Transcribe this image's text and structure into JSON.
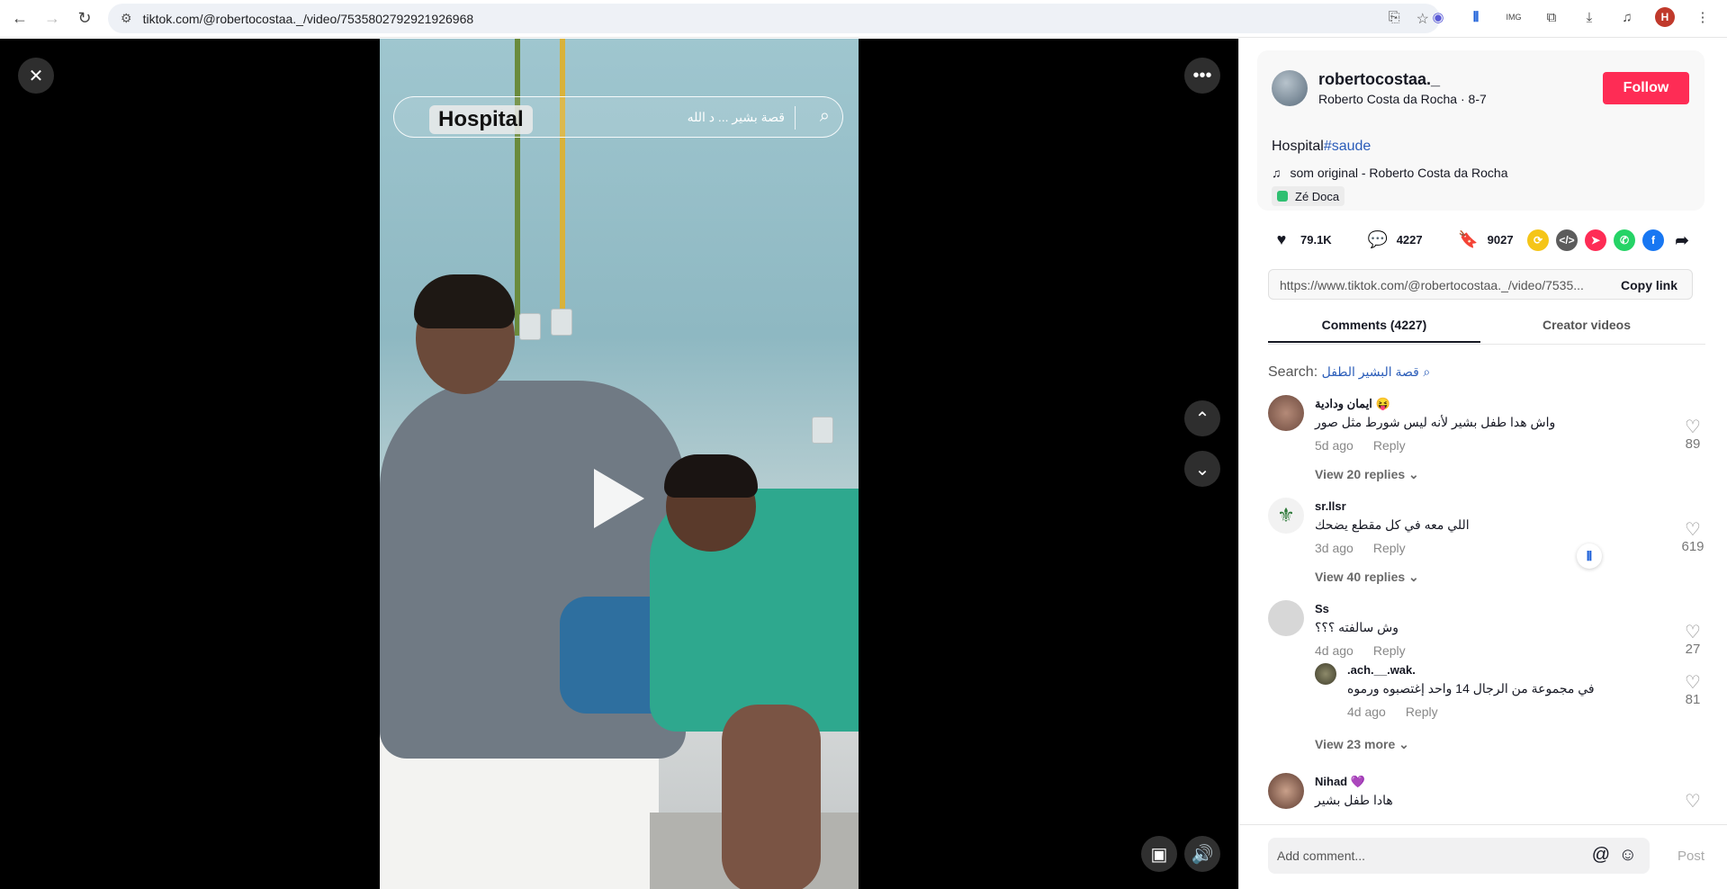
{
  "browser": {
    "url": "tiktok.com/@robertocostaa._/video/7535802792921926968"
  },
  "video": {
    "search_query": "قصة بشير ... د الله",
    "caption_overlay": "Hospital"
  },
  "author": {
    "handle": "robertocostaa._",
    "meta": "Roberto Costa da Rocha · 8-7",
    "follow_label": "Follow",
    "description": "Hospital",
    "hashtag": "#saude",
    "music": "som original - Roberto Costa da Rocha",
    "location": "Zé Doca"
  },
  "stats": {
    "likes": "79.1K",
    "comments": "4227",
    "saves": "9027"
  },
  "link": {
    "url": "https://www.tiktok.com/@robertocostaa._/video/7535...",
    "copy_label": "Copy link"
  },
  "tabs": {
    "comments": "Comments (4227)",
    "creator": "Creator videos"
  },
  "search_suggest": {
    "label": "Search:",
    "term": "قصة البشير الطفل"
  },
  "comments": [
    {
      "user": "ايمان ودادية 😝",
      "text": "واش هدا طفل بشير لأنه ليس شورط مثل صور",
      "date": "5d ago",
      "reply": "Reply",
      "likes": "89",
      "replies": "View 20 replies"
    },
    {
      "user": "sr.llsr",
      "text": "اللي معه في كل مقطع يضحك",
      "date": "3d ago",
      "reply": "Reply",
      "likes": "619",
      "replies": "View 40 replies"
    },
    {
      "user": "Ss",
      "text": "وش سالفته ؟؟؟",
      "date": "4d ago",
      "reply": "Reply",
      "likes": "27",
      "replies": "View 23 more"
    },
    {
      "user": "Nihad 💜",
      "text": "هادا طفل بشير"
    }
  ],
  "sub_comment": {
    "user": ".ach.__.wak.",
    "text": "في مجموعة من الرجال 14 واحد إغتصبوه ورموه",
    "date": "4d ago",
    "reply": "Reply",
    "likes": "81"
  },
  "comment_bar": {
    "placeholder": "Add comment...",
    "post_label": "Post"
  }
}
